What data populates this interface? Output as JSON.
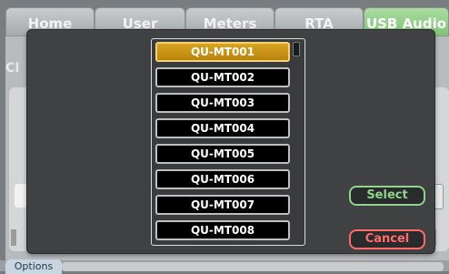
{
  "tabs": [
    {
      "label": "Home",
      "active": false
    },
    {
      "label": "User",
      "active": false
    },
    {
      "label": "Meters",
      "active": false
    },
    {
      "label": "RTA",
      "active": false
    },
    {
      "label": "USB Audio",
      "active": true
    }
  ],
  "background": {
    "side_label": "CI",
    "options_label": "Options"
  },
  "dialog": {
    "items": [
      "QU-MT001",
      "QU-MT002",
      "QU-MT003",
      "QU-MT004",
      "QU-MT005",
      "QU-MT006",
      "QU-MT007",
      "QU-MT008"
    ],
    "selected_index": 0,
    "select_label": "Select",
    "cancel_label": "Cancel"
  },
  "colors": {
    "selected_item": "#d9a521",
    "select_button": "#8fd48a",
    "cancel_button": "#ff6a6a",
    "active_tab": "#8fd187"
  }
}
